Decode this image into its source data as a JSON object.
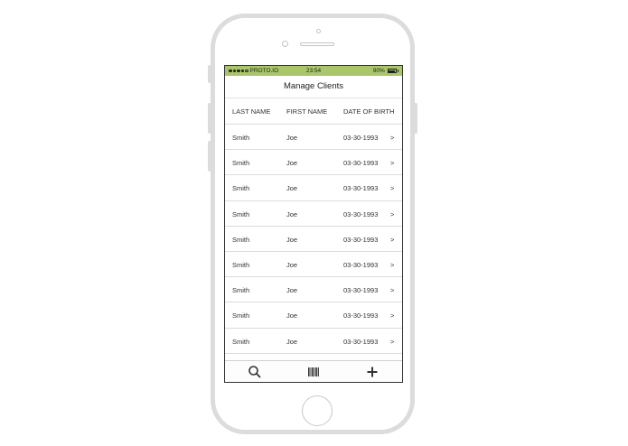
{
  "status_bar": {
    "carrier": "PROTO.IO",
    "time": "23:54",
    "battery": "90%",
    "battery_level": 0.9
  },
  "nav": {
    "title": "Manage Clients"
  },
  "table": {
    "headers": [
      "LAST NAME",
      "FIRST NAME",
      "DATE OF BIRTH"
    ],
    "rows": [
      {
        "last": "Smith",
        "first": "Joe",
        "dob": "03-30-1993",
        "chevron": ">"
      },
      {
        "last": "Smith",
        "first": "Joe",
        "dob": "03-30-1993",
        "chevron": ">"
      },
      {
        "last": "Smith",
        "first": "Joe",
        "dob": "03-30-1993",
        "chevron": ">"
      },
      {
        "last": "Smith",
        "first": "Joe",
        "dob": "03-30-1993",
        "chevron": ">"
      },
      {
        "last": "Smith",
        "first": "Joe",
        "dob": "03-30-1993",
        "chevron": ">"
      },
      {
        "last": "Smith",
        "first": "Joe",
        "dob": "03-30-1993",
        "chevron": ">"
      },
      {
        "last": "Smith",
        "first": "Joe",
        "dob": "03-30-1993",
        "chevron": ">"
      },
      {
        "last": "Smith",
        "first": "Joe",
        "dob": "03-30-1993",
        "chevron": ">"
      },
      {
        "last": "Smith",
        "first": "Joe",
        "dob": "03-30-1993",
        "chevron": ">"
      }
    ]
  },
  "tab_bar": {
    "icons": [
      "search-icon",
      "barcode-icon",
      "plus-icon"
    ]
  },
  "colors": {
    "status_bar_bg": "#a9c66a",
    "phone_frame": "#dcdcdc",
    "icon_color": "#333333"
  }
}
